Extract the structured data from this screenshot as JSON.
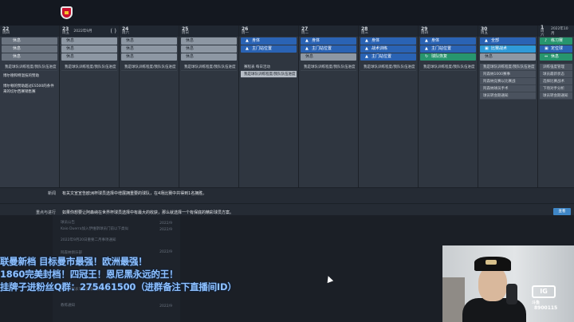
{
  "calendar": {
    "columns": [
      {
        "day": "22",
        "weekday": "周四",
        "extra": ""
      },
      {
        "day": "23",
        "weekday": "周五",
        "extra": "2022年9月"
      },
      {
        "day": "24",
        "weekday": "周六",
        "extra": ""
      },
      {
        "day": "25",
        "weekday": "周日",
        "extra": ""
      },
      {
        "day": "26",
        "weekday": "周一",
        "extra": ""
      },
      {
        "day": "27",
        "weekday": "周二",
        "extra": ""
      },
      {
        "day": "28",
        "weekday": "周三",
        "extra": ""
      },
      {
        "day": "29",
        "weekday": "周四",
        "extra": ""
      },
      {
        "day": "30",
        "weekday": "周五",
        "extra": ""
      },
      {
        "day": "1",
        "weekday": "周六",
        "extra": "2022年10月"
      }
    ],
    "refresh_glyph": "( )",
    "rest": "休息",
    "body": "身体",
    "set_piece": "定位球",
    "tactics": "战术训练",
    "match_prep": "比赛战术",
    "goal_pos": "主门站位置",
    "recovery": "球队恢复",
    "full": "全部",
    "review": "练习赛",
    "schedule_fill": "我是球队训练程度/我队队伍进度"
  },
  "lead": {
    "note_a": "博尔德和特温技的赞助",
    "note_b": "博尔顿的赞助超过ES500的条件\n来的切尔西赛销售赛"
  },
  "act_rows": {
    "a": "我是球队训练程度/我队队伍进度",
    "b": "赛程表 每日活动",
    "c": "阿森纳1000赛事",
    "d": "阿森纳竞赛以比赛战",
    "e": "阿森纳球员手术",
    "f": "球员转会期通知",
    "g": "训练强度管理",
    "h": "球员最新状态",
    "i": "选择比赛战术",
    "j": "下场对手分析"
  },
  "panels": {
    "news_label": "新闻",
    "news_text": "有关文宣宣告欧洲杯球员选择中增展拥重要的球队，在4场比赛中共得到1名拥胜。",
    "task_label": "重点与进行",
    "task_text": "如果你想要让阿森纳在世界杯球员选择中有最大的收获，那么就选择一个有保底的精彩球员方案。",
    "check_button": "查看"
  },
  "inbox": {
    "item1": "球员公告",
    "item1_time": "2022/9",
    "item2": "Kaio Duerra加入伊维斯球员门前以下类似",
    "item2_time": "2022/9",
    "item3": "2022年9月20日重要二月事项通知",
    "item4": "阿森纳俱乐部",
    "item5": "比赛日程表可以安排球员训练",
    "item6": "教练通知"
  },
  "overlay": {
    "line1": "联曼新档 目标曼市最强！欧洲最强！",
    "line2": "1860完美封档！四冠王！恩尼黑永远的王！",
    "line3": "挂牌子进粉丝Q群：275461500（进群备注下直播间ID）"
  },
  "webcam": {
    "badge": "IG",
    "sub": "斗鱼",
    "num": "8900115"
  }
}
